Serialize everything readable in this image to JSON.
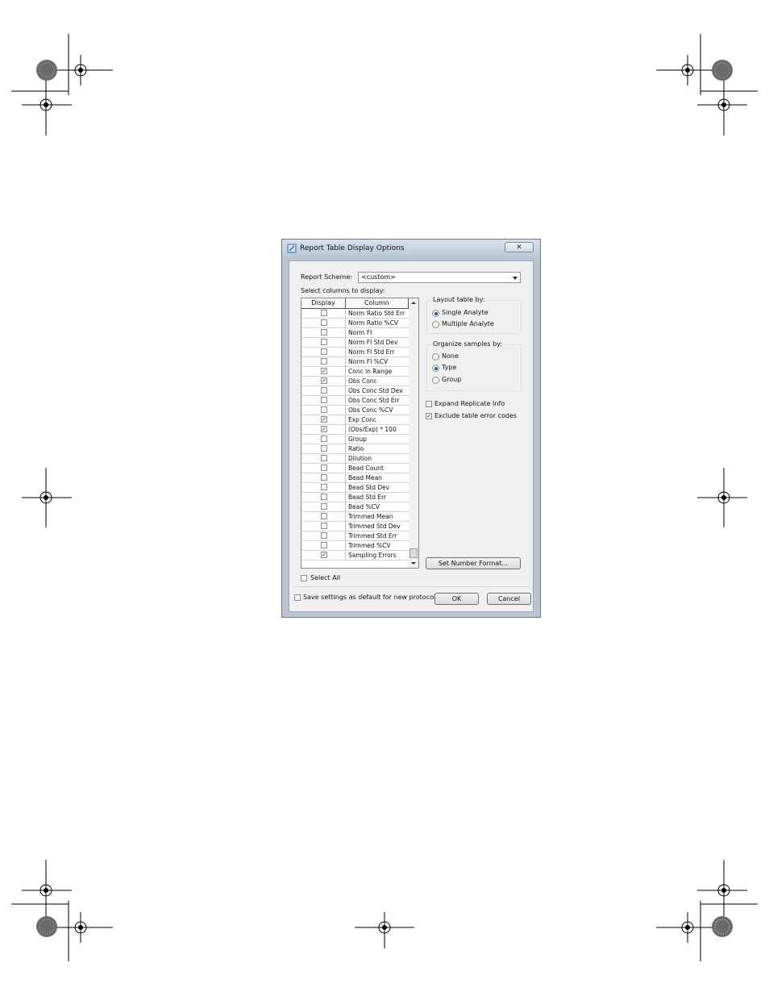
{
  "dialog": {
    "title": "Report Table Display Options",
    "close_glyph": "✕",
    "report_scheme_label": "Report Scheme:",
    "report_scheme_value": "<custom>",
    "select_columns_label": "Select columns to display:",
    "grid": {
      "headers": [
        "Display",
        "Column"
      ],
      "rows": [
        {
          "name": "Norm Ratio Std Err",
          "checked": false
        },
        {
          "name": "Norm Ratio %CV",
          "checked": false
        },
        {
          "name": "Norm FI",
          "checked": false
        },
        {
          "name": "Norm FI Std Dev",
          "checked": false
        },
        {
          "name": "Norm FI Std Err",
          "checked": false
        },
        {
          "name": "Norm FI %CV",
          "checked": false
        },
        {
          "name": "Conc in Range",
          "checked": true
        },
        {
          "name": "Obs Conc",
          "checked": true
        },
        {
          "name": "Obs Conc Std Dev",
          "checked": false
        },
        {
          "name": "Obs Conc Std Err",
          "checked": false
        },
        {
          "name": "Obs Conc %CV",
          "checked": false
        },
        {
          "name": "Exp Conc",
          "checked": true
        },
        {
          "name": "(Obs/Exp) * 100",
          "checked": true
        },
        {
          "name": "Group",
          "checked": false
        },
        {
          "name": "Ratio",
          "checked": false
        },
        {
          "name": "Dilution",
          "checked": false
        },
        {
          "name": "Bead Count",
          "checked": false
        },
        {
          "name": "Bead Mean",
          "checked": false
        },
        {
          "name": "Bead Std Dev",
          "checked": false
        },
        {
          "name": "Bead Std Err",
          "checked": false
        },
        {
          "name": "Bead %CV",
          "checked": false
        },
        {
          "name": "Trimmed Mean",
          "checked": false
        },
        {
          "name": "Trimmed Std Dev",
          "checked": false
        },
        {
          "name": "Trimmed Std Err",
          "checked": false
        },
        {
          "name": "Trimmed %CV",
          "checked": false
        },
        {
          "name": "Sampling Errors",
          "checked": true
        }
      ]
    },
    "select_all_label": "Select All",
    "select_all_checked": false,
    "layout": {
      "title": "Layout table by:",
      "options": [
        {
          "label": "Single Analyte",
          "selected": true
        },
        {
          "label": "Multiple Analyte",
          "selected": false
        }
      ]
    },
    "organize": {
      "title": "Organize samples by:",
      "options": [
        {
          "label": "None",
          "selected": false
        },
        {
          "label": "Type",
          "selected": true
        },
        {
          "label": "Group",
          "selected": false
        }
      ]
    },
    "expand_replicate": {
      "label": "Expand Replicate Info",
      "checked": false
    },
    "exclude_errors": {
      "label": "Exclude table error codes",
      "checked": true
    },
    "set_number_format_label": "Set Number Format...",
    "save_default": {
      "label": "Save settings as default for new protocol",
      "checked": false
    },
    "ok_label": "OK",
    "cancel_label": "Cancel",
    "check_glyph": "✓"
  }
}
